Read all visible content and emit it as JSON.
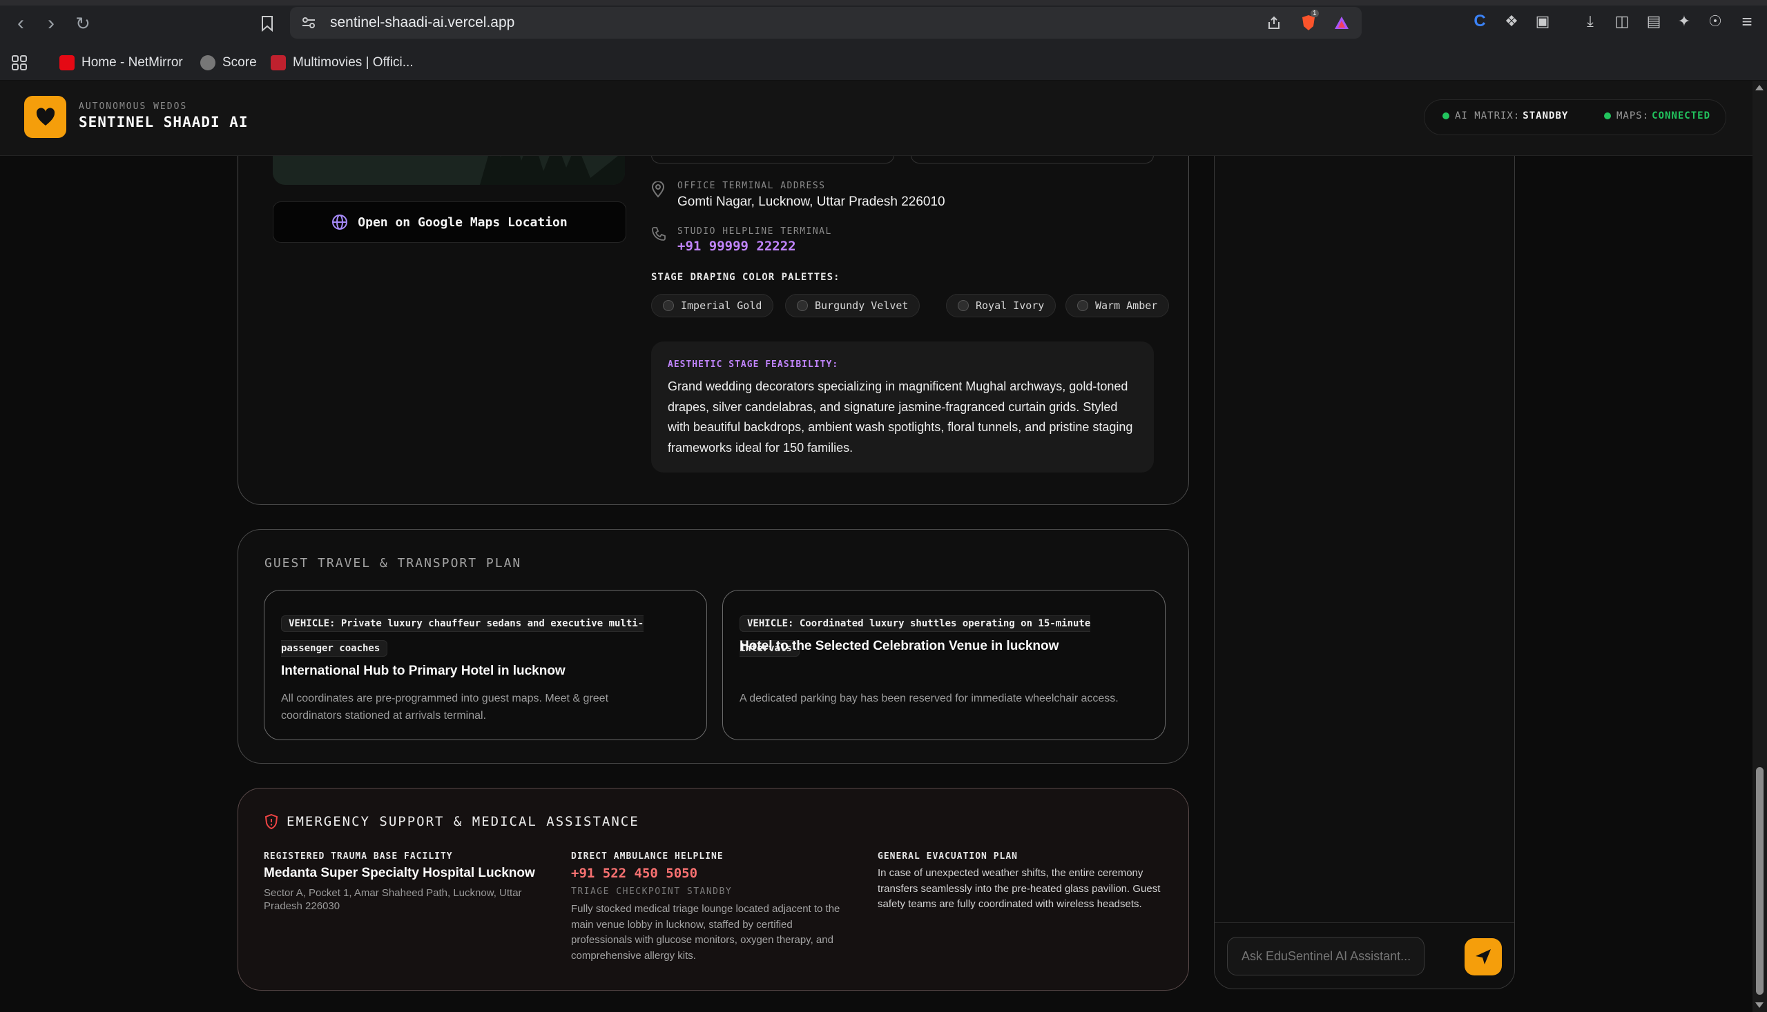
{
  "browser": {
    "url": "sentinel-shaadi-ai.vercel.app",
    "brave_badge": "1",
    "bookmarks": [
      {
        "label": "Home - NetMirror"
      },
      {
        "label": "Score"
      },
      {
        "label": "Multimovies | Offici..."
      }
    ]
  },
  "app": {
    "brand_subtitle": "AUTONOMOUS WEDOS",
    "brand_title": "SENTINEL SHAADI AI",
    "status": {
      "ai_label": "AI MATRIX:",
      "ai_value": "STANDBY",
      "maps_label": "MAPS:",
      "maps_value": "CONNECTED",
      "ai_color": "#22c55e",
      "maps_color": "#22c55e"
    }
  },
  "venue": {
    "maps_button": "Open on Google Maps Location",
    "office_label": "OFFICE TERMINAL ADDRESS",
    "office_address": "Gomti Nagar, Lucknow, Uttar Pradesh 226010",
    "helpline_label": "STUDIO HELPLINE TERMINAL",
    "helpline_number": "+91 99999 22222",
    "palettes_label": "STAGE DRAPING COLOR PALETTES:",
    "palettes": [
      "Imperial Gold",
      "Burgundy Velvet",
      "Royal Ivory",
      "Warm Amber"
    ],
    "feasibility_label": "AESTHETIC STAGE FEASIBILITY:",
    "feasibility_text": "Grand wedding decorators specializing in magnificent Mughal archways, gold-toned drapes, silver candelabras, and signature jasmine-fragranced curtain grids. Styled with beautiful backdrops, ambient wash spotlights, floral tunnels, and pristine staging frameworks ideal for 150 families."
  },
  "transport": {
    "heading": "GUEST TRAVEL & TRANSPORT PLAN",
    "cards": [
      {
        "vehicle": "VEHICLE: Private luxury chauffeur sedans and executive multi-passenger coaches",
        "route": "International Hub to Primary Hotel in lucknow",
        "note": "All coordinates are pre-programmed into guest maps. Meet & greet coordinators stationed at arrivals terminal."
      },
      {
        "vehicle": "VEHICLE: Coordinated luxury shuttles operating on 15-minute intervals",
        "route": "Hotel to the Selected Celebration Venue in lucknow",
        "note": "A dedicated parking bay has been reserved for immediate wheelchair access."
      }
    ]
  },
  "emergency": {
    "heading": "EMERGENCY SUPPORT & MEDICAL ASSISTANCE",
    "facility_label": "REGISTERED TRAUMA BASE FACILITY",
    "facility_name": "Medanta Super Specialty Hospital Lucknow",
    "facility_address": "Sector A, Pocket 1, Amar Shaheed Path, Lucknow, Uttar Pradesh 226030",
    "ambulance_label": "DIRECT AMBULANCE HELPLINE",
    "ambulance_number": "+91 522 450 5050",
    "triage_label": "TRIAGE CHECKPOINT STANDBY",
    "triage_text": "Fully stocked medical triage lounge located adjacent to the main venue lobby in lucknow, staffed by certified professionals with glucose monitors, oxygen therapy, and comprehensive allergy kits.",
    "evac_label": "GENERAL EVACUATION PLAN",
    "evac_text": "In case of unexpected weather shifts, the entire ceremony transfers seamlessly into the pre-heated glass pavilion. Guest safety teams are fully coordinated with wireless headsets."
  },
  "assistant": {
    "placeholder": "Ask EduSentinel AI Assistant..."
  },
  "colors": {
    "accent": "#f59e0b",
    "purple": "#c084fc",
    "danger": "#f87171"
  }
}
